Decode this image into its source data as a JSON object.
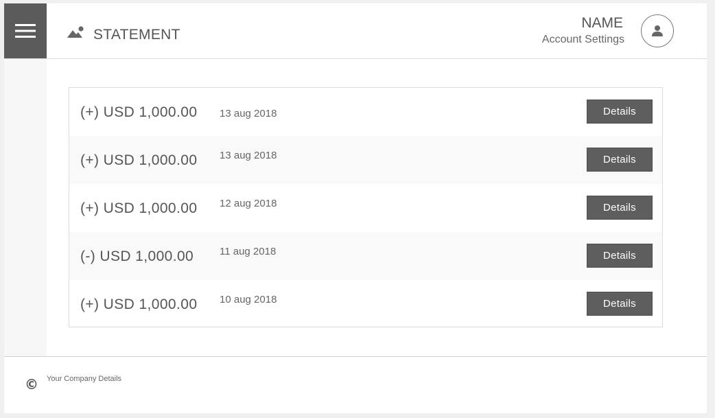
{
  "header": {
    "menu_icon": "hamburger-icon",
    "title_icon": "landscape-icon",
    "title": "STATEMENT",
    "user_name": "NAME",
    "account_settings": "Account Settings",
    "avatar_icon": "user-icon"
  },
  "statement": {
    "rows": [
      {
        "amount": "(+) USD 1,000.00",
        "date": "13 aug 2018",
        "button": "Details"
      },
      {
        "amount": "(+) USD 1,000.00",
        "date": "13 aug 2018",
        "button": "Details"
      },
      {
        "amount": "(+) USD 1,000.00",
        "date": "12 aug 2018",
        "button": "Details"
      },
      {
        "amount": "(-) USD 1,000.00",
        "date": "11 aug 2018",
        "button": "Details"
      },
      {
        "amount": "(+) USD 1,000.00",
        "date": "10 aug 2018",
        "button": "Details"
      }
    ]
  },
  "footer": {
    "copyright_icon": "copyright-icon",
    "copyright_glyph": "©",
    "company": "Your Company Details"
  },
  "colors": {
    "dark": "#5b5b5b",
    "text": "#555555",
    "border": "#dcdcdc",
    "alt_row": "#f9f9f9"
  }
}
